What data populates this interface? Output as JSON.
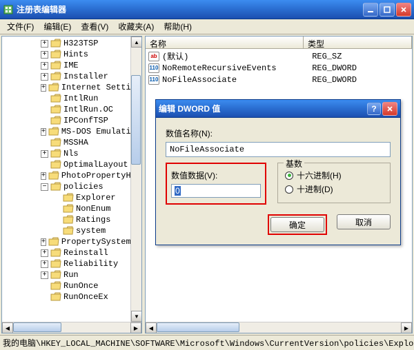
{
  "window": {
    "title": "注册表编辑器"
  },
  "menu": {
    "file": "文件(F)",
    "edit": "编辑(E)",
    "view": "查看(V)",
    "fav": "收藏夹(A)",
    "help": "帮助(H)"
  },
  "tree": {
    "items": [
      {
        "indent": 0,
        "exp": "+",
        "label": "H323TSP"
      },
      {
        "indent": 0,
        "exp": "+",
        "label": "Hints"
      },
      {
        "indent": 0,
        "exp": "+",
        "label": "IME"
      },
      {
        "indent": 0,
        "exp": "+",
        "label": "Installer"
      },
      {
        "indent": 0,
        "exp": "+",
        "label": "Internet Setti"
      },
      {
        "indent": 0,
        "exp": "",
        "label": "IntlRun"
      },
      {
        "indent": 0,
        "exp": "",
        "label": "IntlRun.OC"
      },
      {
        "indent": 0,
        "exp": "",
        "label": "IPConfTSP"
      },
      {
        "indent": 0,
        "exp": "+",
        "label": "MS-DOS Emulati"
      },
      {
        "indent": 0,
        "exp": "",
        "label": "MSSHA"
      },
      {
        "indent": 0,
        "exp": "+",
        "label": "Nls"
      },
      {
        "indent": 0,
        "exp": "",
        "label": "OptimalLayout"
      },
      {
        "indent": 0,
        "exp": "+",
        "label": "PhotoPropertyH"
      },
      {
        "indent": 0,
        "exp": "-",
        "label": "policies"
      },
      {
        "indent": 1,
        "exp": "",
        "label": "Explorer"
      },
      {
        "indent": 1,
        "exp": "",
        "label": "NonEnum"
      },
      {
        "indent": 1,
        "exp": "",
        "label": "Ratings"
      },
      {
        "indent": 1,
        "exp": "",
        "label": "system"
      },
      {
        "indent": 0,
        "exp": "+",
        "label": "PropertySystem"
      },
      {
        "indent": 0,
        "exp": "+",
        "label": "Reinstall"
      },
      {
        "indent": 0,
        "exp": "+",
        "label": "Reliability"
      },
      {
        "indent": 0,
        "exp": "+",
        "label": "Run"
      },
      {
        "indent": 0,
        "exp": "",
        "label": "RunOnce"
      },
      {
        "indent": 0,
        "exp": "",
        "label": "RunOnceEx"
      }
    ]
  },
  "list": {
    "col_name": "名称",
    "col_type": "类型",
    "rows": [
      {
        "icon": "sz",
        "name": "(默认)",
        "type": "REG_SZ"
      },
      {
        "icon": "dw",
        "name": "NoRemoteRecursiveEvents",
        "type": "REG_DWORD"
      },
      {
        "icon": "dw",
        "name": "NoFileAssociate",
        "type": "REG_DWORD"
      }
    ]
  },
  "dialog": {
    "title": "编辑 DWORD 值",
    "name_label": "数值名称(N):",
    "name_value": "NoFileAssociate",
    "data_label": "数值数据(V):",
    "data_value": "0",
    "base_label": "基数",
    "radio_hex": "十六进制(H)",
    "radio_dec": "十进制(D)",
    "ok": "确定",
    "cancel": "取消"
  },
  "statusbar": "我的电脑\\HKEY_LOCAL_MACHINE\\SOFTWARE\\Microsoft\\Windows\\CurrentVersion\\policies\\Explorer"
}
